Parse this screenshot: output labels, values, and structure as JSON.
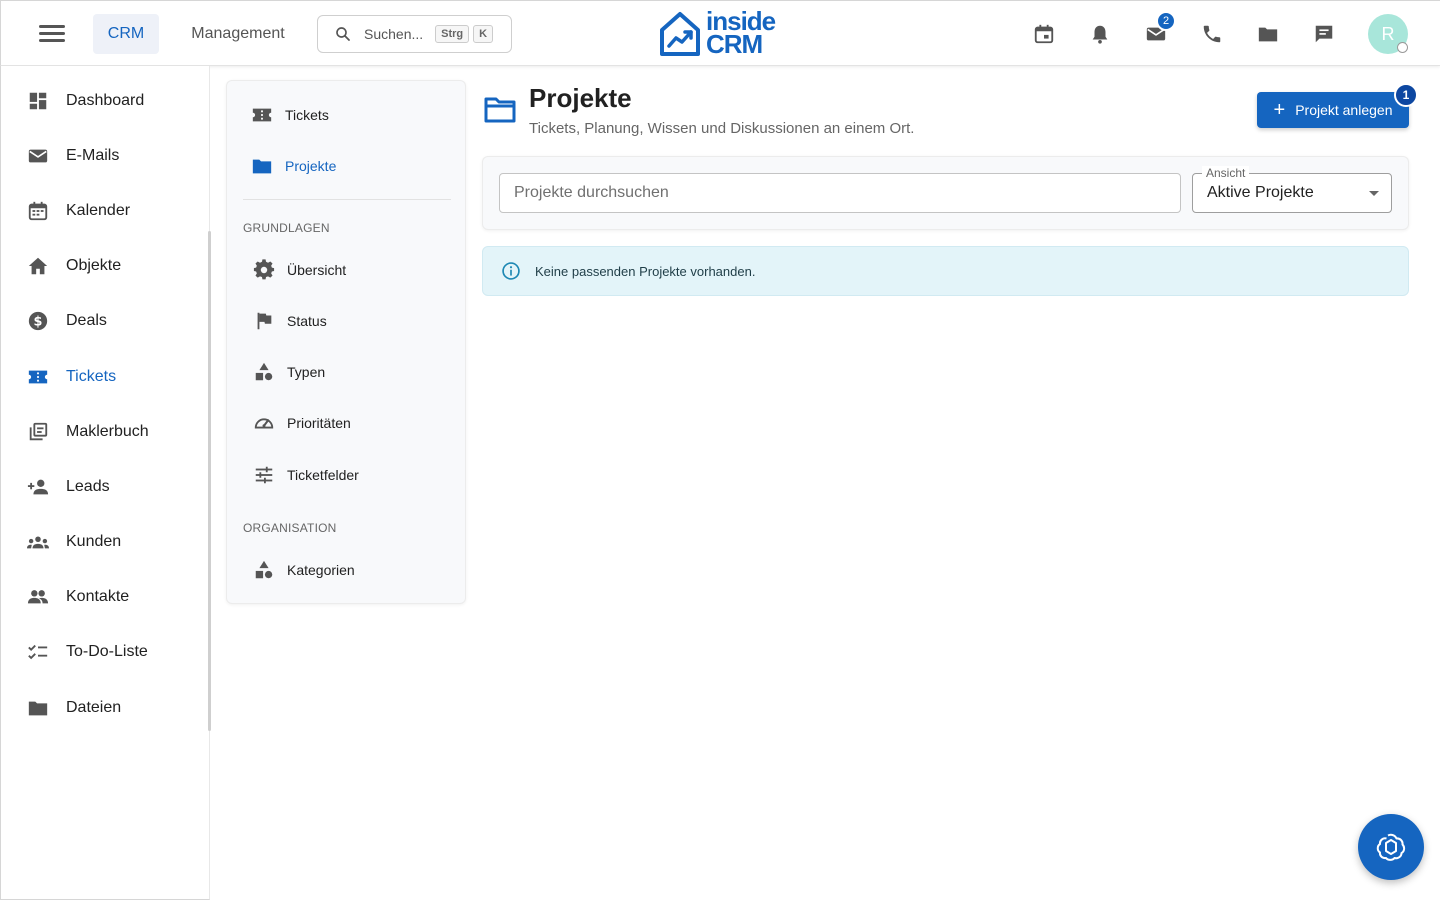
{
  "topbar": {
    "tabs": [
      {
        "label": "CRM",
        "active": true
      },
      {
        "label": "Management",
        "active": false
      }
    ],
    "search": {
      "placeholder": "Suchen...",
      "shortcut_keys": [
        "Strg",
        "K"
      ]
    },
    "logo": {
      "line1": "inside",
      "line2": "CRM"
    },
    "icons": [
      "calendar-icon",
      "bell-icon",
      "mail-icon",
      "phone-icon",
      "folder-icon",
      "chat-icon"
    ],
    "mail_badge": "2",
    "avatar_initial": "R"
  },
  "sidebar": {
    "items": [
      {
        "label": "Dashboard",
        "icon": "dashboard-icon",
        "active": false
      },
      {
        "label": "E-Mails",
        "icon": "mail-icon",
        "active": false
      },
      {
        "label": "Kalender",
        "icon": "calendar-icon",
        "active": false
      },
      {
        "label": "Objekte",
        "icon": "house-icon",
        "active": false
      },
      {
        "label": "Deals",
        "icon": "dollar-icon",
        "active": false
      },
      {
        "label": "Tickets",
        "icon": "ticket-icon",
        "active": true
      },
      {
        "label": "Maklerbuch",
        "icon": "library-icon",
        "active": false
      },
      {
        "label": "Leads",
        "icon": "person-add-icon",
        "active": false
      },
      {
        "label": "Kunden",
        "icon": "groups-icon",
        "active": false
      },
      {
        "label": "Kontakte",
        "icon": "people-icon",
        "active": false
      },
      {
        "label": "To-Do-Liste",
        "icon": "checklist-icon",
        "active": false
      },
      {
        "label": "Dateien",
        "icon": "folder-icon",
        "active": false
      }
    ]
  },
  "subnav": {
    "top_items": [
      {
        "label": "Tickets",
        "icon": "ticket-icon",
        "active": false
      },
      {
        "label": "Projekte",
        "icon": "folder-icon",
        "active": true
      }
    ],
    "section1_heading": "GRUNDLAGEN",
    "section1_items": [
      {
        "label": "Übersicht",
        "icon": "gear-icon"
      },
      {
        "label": "Status",
        "icon": "flag-icon"
      },
      {
        "label": "Typen",
        "icon": "shapes-icon"
      },
      {
        "label": "Prioritäten",
        "icon": "speedometer-icon"
      },
      {
        "label": "Ticketfelder",
        "icon": "tune-icon"
      }
    ],
    "section2_heading": "ORGANISATION",
    "section2_items": [
      {
        "label": "Kategorien",
        "icon": "shapes-icon"
      }
    ]
  },
  "main": {
    "title": "Projekte",
    "subtitle": "Tickets, Planung, Wissen und Diskussionen an einem Ort.",
    "create_button": "Projekt anlegen",
    "create_badge": "1",
    "search_placeholder": "Projekte durchsuchen",
    "view_label": "Ansicht",
    "view_value": "Aktive Projekte",
    "empty_message": "Keine passenden Projekte vorhanden."
  },
  "colors": {
    "primary": "#1565c0",
    "alert_bg": "#e3f4f9",
    "avatar_bg": "#a8e6da"
  }
}
